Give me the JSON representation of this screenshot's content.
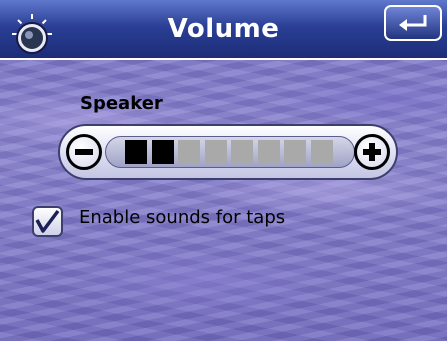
{
  "header": {
    "title": "Volume"
  },
  "speaker": {
    "label": "Speaker",
    "level": 2,
    "max_level": 8
  },
  "options": {
    "enable_tap_sounds_label": "Enable sounds for taps",
    "enable_tap_sounds_checked": true
  },
  "icons": {
    "volume": "volume-knob-icon",
    "back": "back-arrow-icon",
    "decrease": "minus-icon",
    "increase": "plus-icon",
    "check": "checkmark-icon"
  },
  "colors": {
    "header_dark": "#1d2c78",
    "header_light": "#5f78cc",
    "background": "#7d76c9",
    "segment_on": "#000000",
    "segment_off": "#a9a9a9"
  }
}
